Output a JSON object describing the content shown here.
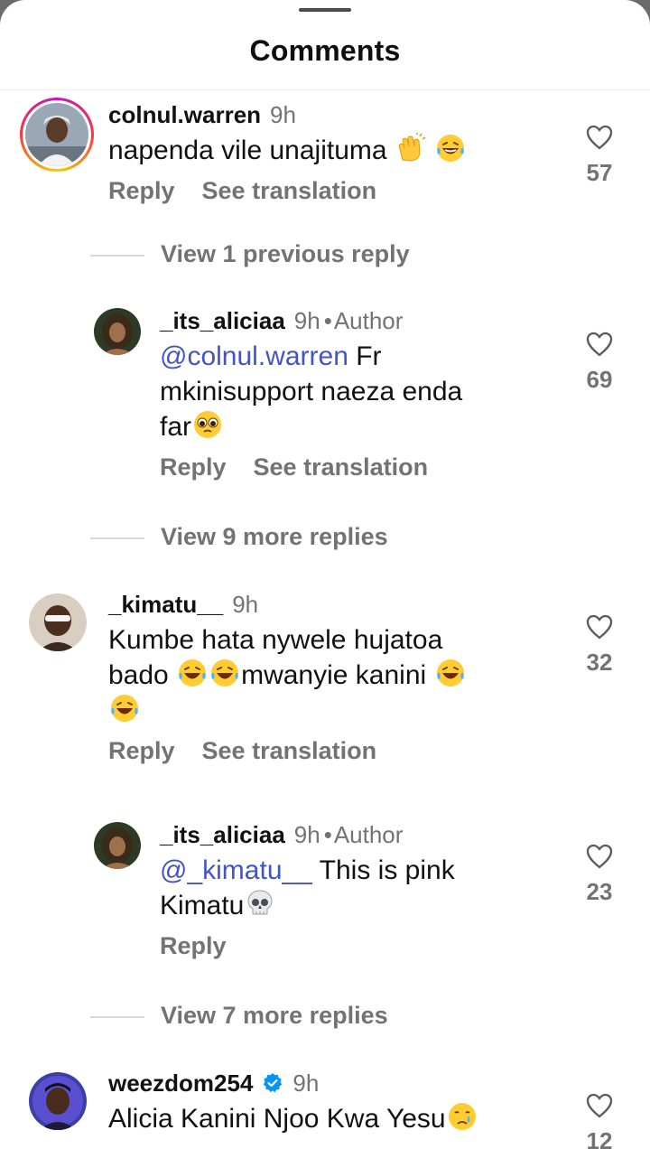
{
  "sheet": {
    "title": "Comments"
  },
  "comments": [
    {
      "username": "colnul.warren",
      "time": "9h",
      "text": "napenda vile unajituma",
      "emojis": [
        "clap-emoji",
        "laugh-emoji"
      ],
      "reply_label": "Reply",
      "translate_label": "See translation",
      "likes": "57",
      "view_replies": "View 1 previous reply"
    },
    {
      "username": "_its_aliciaa",
      "time": "9h",
      "author_badge": "Author",
      "mention": "@colnul.warren",
      "text_line1": " Fr",
      "text_line2": "mkinisupport naeza enda",
      "text_line3": "far",
      "reply_label": "Reply",
      "translate_label": "See translation",
      "likes": "69",
      "view_replies": "View 9 more replies"
    },
    {
      "username": "_kimatu__",
      "time": "9h",
      "text_line1": "Kumbe hata nywele hujatoa",
      "text_line2a": "bado ",
      "text_line2b": "mwanyie kanini ",
      "reply_label": "Reply",
      "translate_label": "See translation",
      "likes": "32"
    },
    {
      "username": "_its_aliciaa",
      "time": "9h",
      "author_badge": "Author",
      "mention": "@_kimatu__",
      "text_line1": " This is pink",
      "text_line2": "Kimatu",
      "reply_label": "Reply",
      "likes": "23",
      "view_replies": "View 7 more replies"
    },
    {
      "username": "weezdom254",
      "time": "9h",
      "text": "Alicia Kanini Njoo Kwa Yesu",
      "likes": "12"
    }
  ],
  "colors": {
    "mention": "#4353c9",
    "secondary_text": "#737373",
    "verified": "#0095f6"
  }
}
